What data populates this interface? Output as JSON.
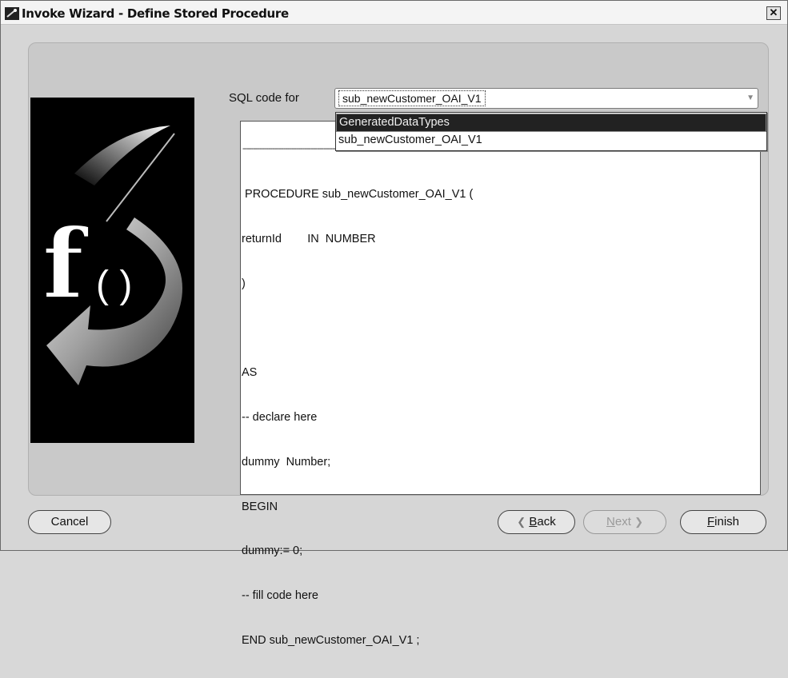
{
  "window": {
    "title": "Invoke Wizard - Define Stored Procedure",
    "close_glyph": "✕"
  },
  "sql": {
    "label": "SQL code for",
    "selected": "sub_newCustomer_OAI_V1",
    "options": [
      "GeneratedDataTypes",
      "sub_newCustomer_OAI_V1"
    ],
    "highlighted_index": 0
  },
  "code": {
    "separator": "--------------------------------------------",
    "lines": [
      " PROCEDURE sub_newCustomer_OAI_V1 (",
      "returnId        IN  NUMBER",
      ")",
      "",
      "AS",
      "-- declare here",
      "dummy  Number;",
      "BEGIN",
      "dummy:= 0;",
      "-- fill code here",
      "END sub_newCustomer_OAI_V1 ;"
    ]
  },
  "buttons": {
    "cancel": "Cancel",
    "back_mnemonic": "B",
    "back_rest": "ack",
    "next_mnemonic": "N",
    "next_rest": "ext",
    "finish_mnemonic": "F",
    "finish_rest": "inish"
  },
  "icons": {
    "window_icon": "wizard-icon",
    "banner": "function-banner-icon",
    "back_arrow": "chevron-left-icon",
    "next_arrow": "chevron-right-icon",
    "combo_arrow": "chevron-down-icon"
  }
}
